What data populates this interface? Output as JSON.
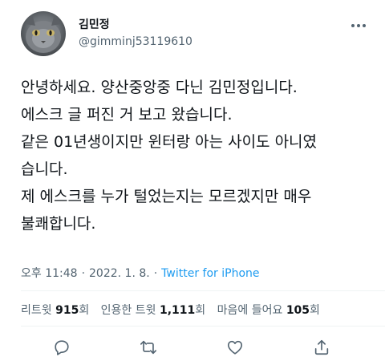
{
  "user": {
    "name": "김민정",
    "handle": "@gimminj53119610",
    "avatar_icon": "cat-avatar"
  },
  "tweet": {
    "lines": [
      "안녕하세요. 양산중앙중 다닌 김민정입니다.",
      "에스크 글 퍼진 거 보고 왔습니다.",
      "같은 01년생이지만 윈터랑 아는 사이도 아니였",
      "습니다.",
      "제 에스크를 누가 털었는지는 모르겠지만 매우",
      "불쾌합니다."
    ]
  },
  "meta": {
    "time": "오후 11:48",
    "separator": "·",
    "date": "2022. 1. 8.",
    "source": "Twitter for iPhone"
  },
  "stats": {
    "retweets_label": "리트윗",
    "retweets_count": "915",
    "retweets_unit": "회",
    "quotes_label": "인용한 트윗",
    "quotes_count": "1,111",
    "quotes_unit": "회",
    "likes_label": "마음에 들어요",
    "likes_count": "105",
    "likes_unit": "회"
  },
  "actions": {
    "reply_icon": "reply-icon",
    "retweet_icon": "retweet-icon",
    "like_icon": "heart-icon",
    "share_icon": "share-icon"
  },
  "colors": {
    "text": "#0f1419",
    "secondary": "#536471",
    "link": "#1d9bf0",
    "divider": "#eff3f4"
  }
}
